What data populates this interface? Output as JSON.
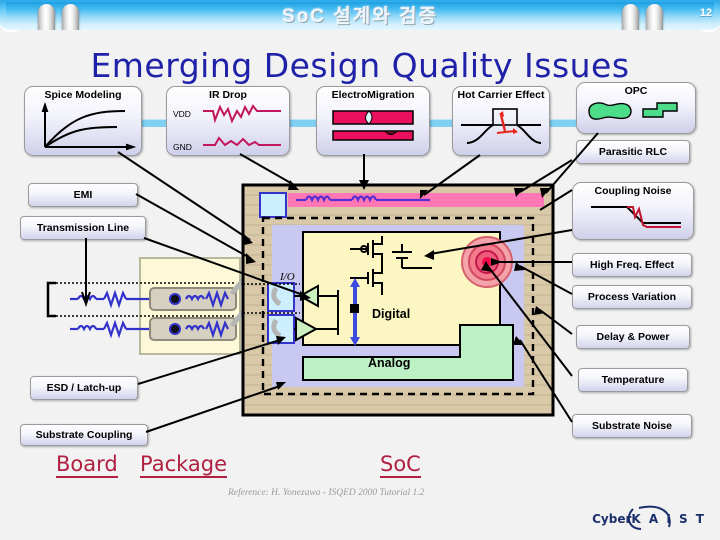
{
  "header": {
    "title": "SoC 설계와 검증",
    "page_number": "12"
  },
  "slide": {
    "title": "Emerging Design Quality Issues",
    "reference": "Reference: H. Yonezawa - ISQED 2000 Tutorial 1.2"
  },
  "top_boxes": [
    {
      "label": "Spice Modeling",
      "icon": "rc-charging-curves-icon"
    },
    {
      "label": "IR Drop",
      "icon": "vdd-gnd-waveform-icon",
      "sub_labels": [
        "VDD",
        "GND"
      ]
    },
    {
      "label": "ElectroMigration",
      "icon": "metal-void-hillock-icon"
    },
    {
      "label": "Hot Carrier Effect",
      "icon": "hot-carrier-injection-icon"
    },
    {
      "label": "OPC",
      "icon": "optical-proximity-shapes-icon"
    }
  ],
  "left_labels": [
    {
      "label": "EMI"
    },
    {
      "label": "Transmission Line"
    },
    {
      "label": "ESD / Latch-up"
    },
    {
      "label": "Substrate Coupling"
    }
  ],
  "right_labels": [
    {
      "label": "Parasitic RLC"
    },
    {
      "label": "Coupling Noise",
      "icon": "crosstalk-waveform-icon"
    },
    {
      "label": "High Freq. Effect"
    },
    {
      "label": "Process Variation"
    },
    {
      "label": "Delay & Power"
    },
    {
      "label": "Temperature"
    },
    {
      "label": "Substrate Noise"
    }
  ],
  "diagram": {
    "io_label": "I/O",
    "digital_label": "Digital",
    "analog_label": "Analog"
  },
  "regions": [
    {
      "label": "Board"
    },
    {
      "label": "Package"
    },
    {
      "label": "SoC"
    }
  ],
  "logo": {
    "prefix": "Cyber",
    "name": "K A I S T"
  },
  "colors": {
    "banner": "#2aa8e8",
    "title": "#1f21a8",
    "region_text": "#b02040",
    "substrate": "#d9c9a8",
    "digital": "#fcf7c2",
    "analog": "#bdf0c4",
    "ring": "#c8c8f0",
    "power_rail": "#ff77b4",
    "trace": "#3333cc"
  }
}
